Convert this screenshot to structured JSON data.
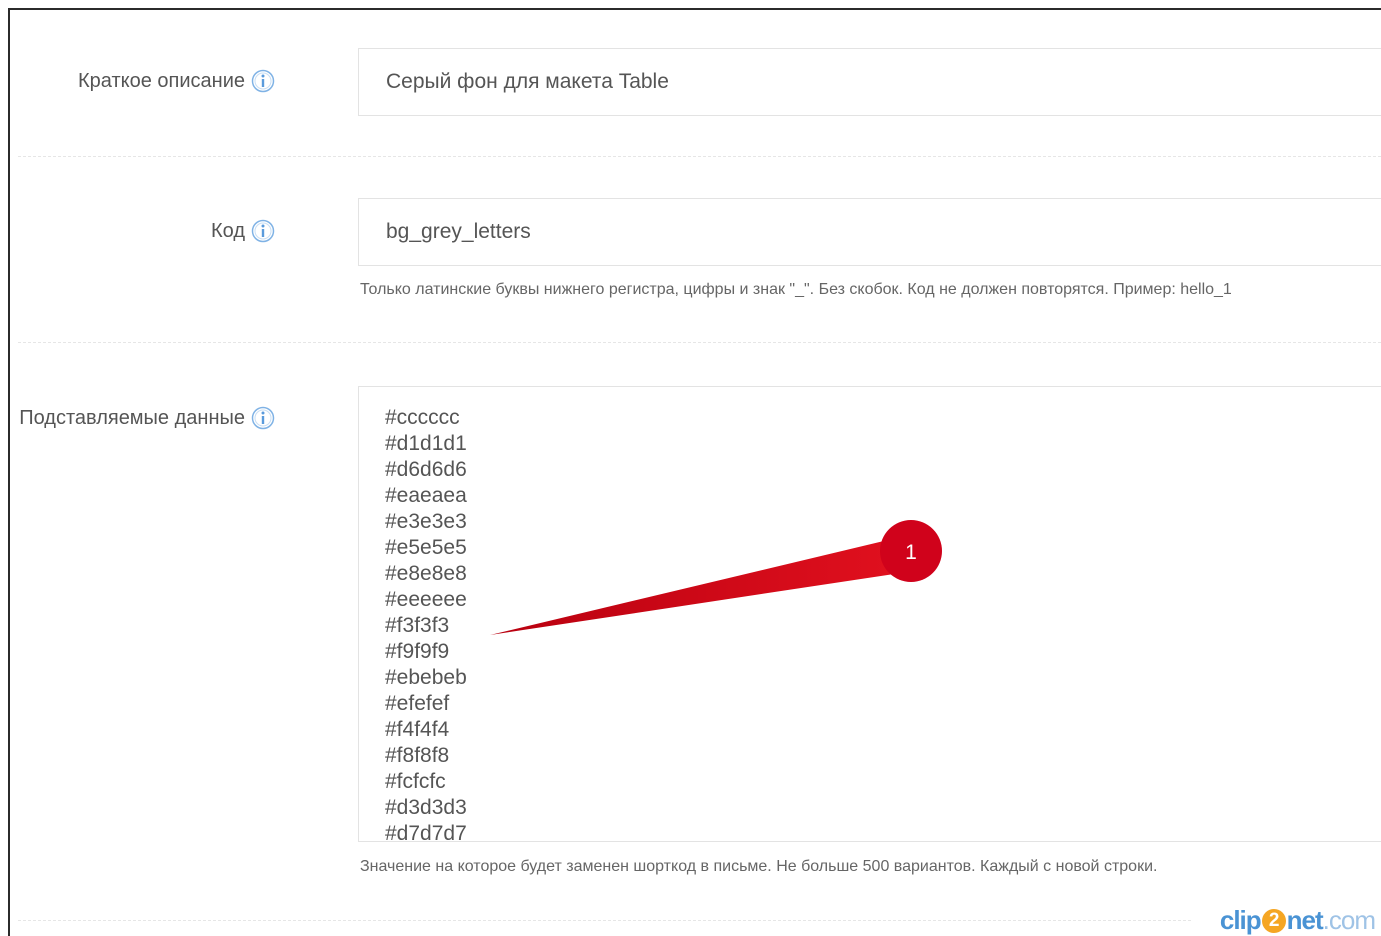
{
  "fields": {
    "short_description": {
      "label": "Краткое описание",
      "value": "Серый фон для макета Table"
    },
    "code": {
      "label": "Код",
      "value": "bg_grey_letters",
      "hint": "Только латинские буквы нижнего регистра, цифры и знак \"_\". Без скобок. Код не должен повторятся. Пример: hello_1"
    },
    "substitution_data": {
      "label": "Подставляемые данные",
      "lines": [
        "#cccccc",
        "#d1d1d1",
        "#d6d6d6",
        "#eaeaea",
        "#e3e3e3",
        "#e5e5e5",
        "#e8e8e8",
        "#eeeeee",
        "#f3f3f3",
        "#f9f9f9",
        "#ebebeb",
        "#efefef",
        "#f4f4f4",
        "#f8f8f8",
        "#fcfcfc",
        "#d3d3d3",
        "#d7d7d7"
      ],
      "hint": "Значение на которое будет заменен шорткод в письме. Не больше 500 вариантов. Каждый с новой строки."
    }
  },
  "icons": {
    "info": "info-icon"
  },
  "annotation": {
    "number": "1",
    "color": "#d0021b"
  },
  "watermark": {
    "part1": "clip",
    "digit": "2",
    "part2": "net",
    "part3": ".com"
  }
}
